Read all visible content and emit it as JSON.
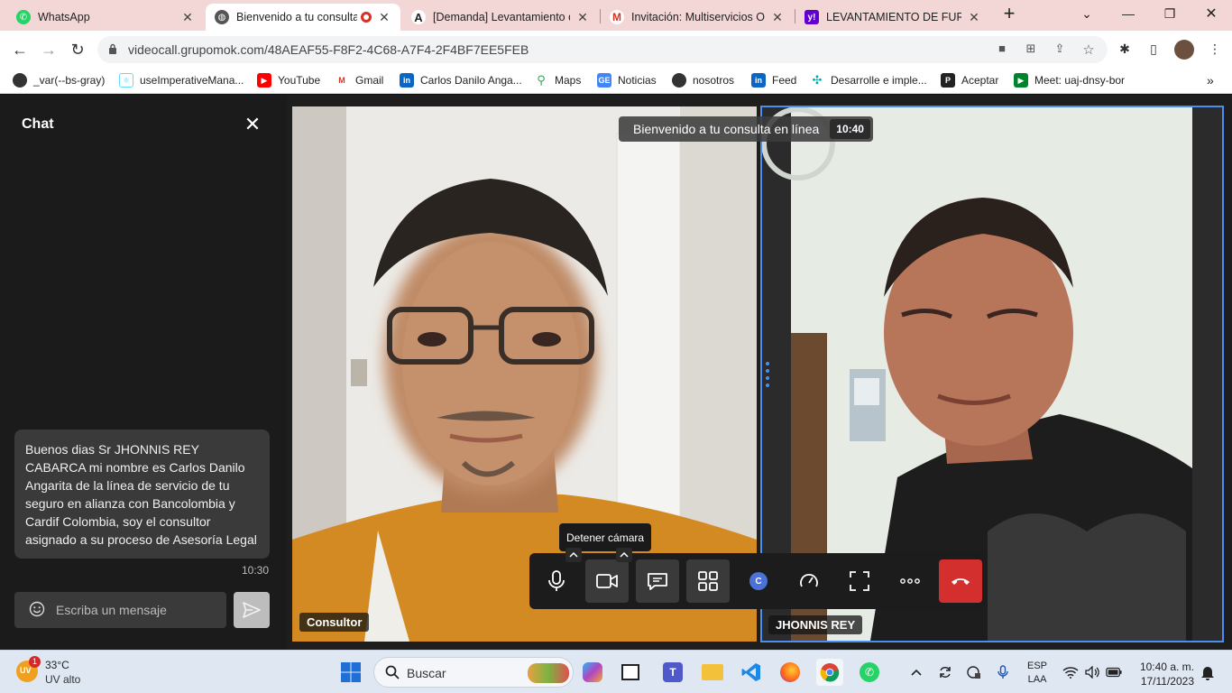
{
  "browser": {
    "tabs": [
      {
        "title": "WhatsApp",
        "icon": "whatsapp-icon",
        "active": false
      },
      {
        "title": "Bienvenido a tu consulta",
        "icon": "globe-icon",
        "active": true,
        "recording": true
      },
      {
        "title": "[Demanda] Levantamiento de",
        "icon": "a-letter-icon",
        "active": false
      },
      {
        "title": "Invitación: Multiservicios OK",
        "icon": "gmail-icon",
        "active": false
      },
      {
        "title": "LEVANTAMIENTO DE FURO",
        "icon": "yahoo-icon",
        "active": false
      }
    ],
    "new_tab_label": "+",
    "url": "videocall.grupomok.com/48AEAF55-F8F2-4C68-A7F4-2F4BF7EE5FEB",
    "bookmarks": [
      {
        "label": "_var(--bs-gray)",
        "icon": "globe-icon"
      },
      {
        "label": "useImperativeMana...",
        "icon": "react-icon"
      },
      {
        "label": "YouTube",
        "icon": "youtube-icon"
      },
      {
        "label": "Gmail",
        "icon": "gmail-icon"
      },
      {
        "label": "Carlos Danilo Anga...",
        "icon": "linkedin-icon"
      },
      {
        "label": "Maps",
        "icon": "maps-icon"
      },
      {
        "label": "Noticias",
        "icon": "news-icon"
      },
      {
        "label": "nosotros",
        "icon": "globe-icon"
      },
      {
        "label": "Feed",
        "icon": "linkedin-icon"
      },
      {
        "label": "Desarrolle e imple...",
        "icon": "azure-icon"
      },
      {
        "label": "Aceptar",
        "icon": "p-letter-icon"
      },
      {
        "label": "Meet: uaj-dnsy-bor",
        "icon": "meet-icon"
      }
    ]
  },
  "chat": {
    "title": "Chat",
    "message": {
      "text": "Buenos dias  Sr  JHONNIS REY CABARCA mi nombre es Carlos Danilo Angarita de la línea de servicio de tu seguro en alianza con Bancolombia y Cardif Colombia, soy el consultor asignado a su proceso de Asesoría Legal",
      "time": "10:30"
    },
    "input_placeholder": "Escriba un mensaje"
  },
  "call": {
    "title": "Bienvenido a tu consulta en línea",
    "elapsed": "10:40",
    "participants": [
      {
        "name": "Consultor"
      },
      {
        "name": "JHONNIS REY"
      }
    ],
    "tooltip": "Detener cámara",
    "controls": [
      "mic-icon",
      "camera-icon",
      "chat-icon",
      "layout-grid-icon",
      "avatar-c-icon",
      "speedometer-icon",
      "fullscreen-icon",
      "more-icon",
      "end-call-icon"
    ],
    "avatar_letter": "C"
  },
  "taskbar": {
    "weather_temp": "33°C",
    "weather_desc": "UV alto",
    "weather_badge": "1",
    "weather_badge_label": "UV",
    "search_label": "Buscar",
    "lang_line1": "ESP",
    "lang_line2": "LAA",
    "time": "10:40 a. m.",
    "date": "17/11/2023"
  }
}
